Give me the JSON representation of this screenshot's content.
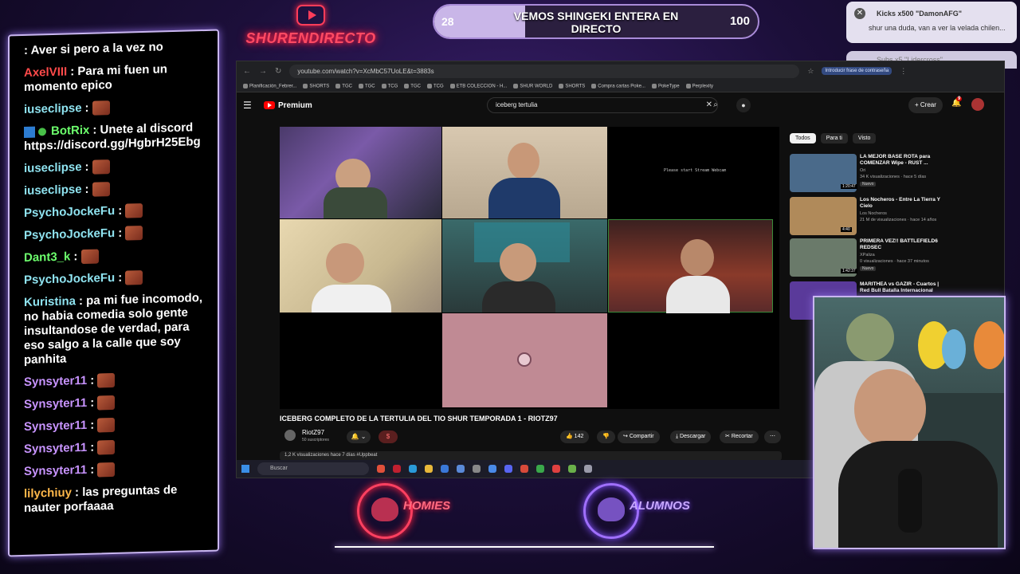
{
  "brand": {
    "name": "SHURENDIRECTO"
  },
  "goal": {
    "current": "28",
    "max": "100",
    "progress": 0.28,
    "title": "VEMOS SHINGEKI ENTERA EN DIRECTO"
  },
  "alert": {
    "close": "✕",
    "title": "Kicks x500 \"DamonAFG\"",
    "text": "shur una duda, van a ver la velada chilen...",
    "next": "Subs x5 \"Lidercross\""
  },
  "chat": [
    {
      "user": "",
      "color": "#ffffff",
      "text": ": Aver si pero a la vez no",
      "emote": false
    },
    {
      "user": "AxelVIII",
      "color": "#ff4a4a",
      "text": ": Para mi fuen un momento epico",
      "emote": false
    },
    {
      "user": "iuseclipse",
      "color": "#8fe3f0",
      "text": ":",
      "emote": true
    },
    {
      "user": "BotRix",
      "color": "#6cff6c",
      "text": ": Unete al discord https://discord.gg/HgbrH25Ebg",
      "emote": false,
      "bot": true
    },
    {
      "user": "iuseclipse",
      "color": "#8fe3f0",
      "text": ":",
      "emote": true
    },
    {
      "user": "iuseclipse",
      "color": "#8fe3f0",
      "text": ":",
      "emote": true
    },
    {
      "user": "PsychoJockeFu",
      "color": "#8fe3f0",
      "text": ":",
      "emote": true
    },
    {
      "user": "PsychoJockeFu",
      "color": "#8fe3f0",
      "text": ":",
      "emote": true
    },
    {
      "user": "Dant3_k",
      "color": "#6cff6c",
      "text": ":",
      "emote": true
    },
    {
      "user": "PsychoJockeFu",
      "color": "#8fe3f0",
      "text": ":",
      "emote": true
    },
    {
      "user": "Kuristina",
      "color": "#8fe3f0",
      "text": ": pa mi fue incomodo, no habia comedia solo gente insultandose de verdad, para eso salgo a la calle que soy panhita",
      "emote": false
    },
    {
      "user": "Synsyter11",
      "color": "#c894ff",
      "text": ":",
      "emote": true
    },
    {
      "user": "Synsyter11",
      "color": "#c894ff",
      "text": ":",
      "emote": true
    },
    {
      "user": "Synsyter11",
      "color": "#c894ff",
      "text": ":",
      "emote": true
    },
    {
      "user": "Synsyter11",
      "color": "#c894ff",
      "text": ":",
      "emote": true
    },
    {
      "user": "Synsyter11",
      "color": "#c894ff",
      "text": ":",
      "emote": true
    },
    {
      "user": "lilychiuy",
      "color": "#ffb84a",
      "text": ": las preguntas de nauter porfaaaa",
      "emote": false
    }
  ],
  "browser": {
    "url": "youtube.com/watch?v=XcMbC57UoLE&t=3883s",
    "password_prompt": "Introducir frase de contraseña",
    "bookmarks": [
      "Planificación_Febrer...",
      "SHORTS",
      "TGC",
      "TGC",
      "TCG",
      "TGC",
      "TCG",
      "ETB COLECCION - H...",
      "SHUR WORLD",
      "SHORTS",
      "Compra cartas Poke...",
      "PokeType",
      "Perplexity"
    ]
  },
  "youtube": {
    "logo": "Premium",
    "search": "iceberg tertulia",
    "create": "+ Crear",
    "bell_count": "9",
    "waiting_text": "Please start Stream Webcam",
    "video_title": "ICEBERG COMPLETO DE LA TERTULIA DEL TIO SHUR TEMPORADA 1 - RIOTZ97",
    "channel": "RiotZ97",
    "subscribers": "50 suscriptores",
    "likes": "142",
    "share": "Compartir",
    "download": "Descargar",
    "clip": "Recortar",
    "more": "⋯",
    "views": "1,2 K visualizaciones  hace 7 días  #Uppbeat",
    "chips": [
      "Todos",
      "Para ti",
      "Visto"
    ],
    "recs": [
      {
        "title": "LA MEJOR BASE ROTA para COMENZAR Wipe - RUST ...",
        "channel": "Ori",
        "meta": "34 K visualizaciones · hace 5 días",
        "badge": "Nuevo",
        "dur": "1:20:47",
        "thumb": "#4a6a8a"
      },
      {
        "title": "Los Nocheros - Entre La Tierra Y Cielo",
        "channel": "Los Nocheros",
        "meta": "21 M de visualizaciones · hace 14 años",
        "badge": "",
        "dur": "4:40",
        "thumb": "#b08a5a"
      },
      {
        "title": "PRIMERA VEZ!! BATTLEFIELD6 REDSEC",
        "channel": "XPaliza",
        "meta": "0 visualizaciones · hace 37 minutos",
        "badge": "Nuevo",
        "dur": "1:42:37",
        "thumb": "#6a7a6a"
      },
      {
        "title": "MARITHEA vs GAZIR - Cuartos | Red Bull Batalla Internacional",
        "channel": "",
        "meta": "",
        "badge": "",
        "dur": "",
        "thumb": "#5a3a9a"
      }
    ]
  },
  "taskbar": {
    "search": "Buscar"
  },
  "logos": {
    "homies": "HOMIES",
    "alumnos": "ALUMNOS"
  }
}
